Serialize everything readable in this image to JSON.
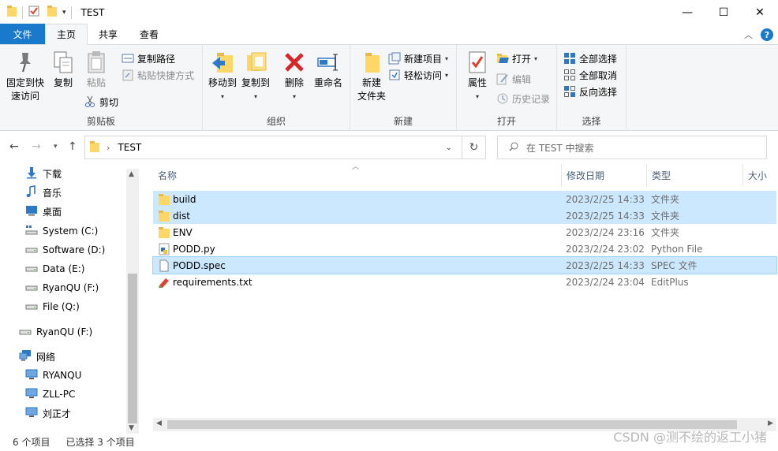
{
  "window": {
    "title": "TEST",
    "minimize_glyph": "—",
    "maximize_glyph": "☐",
    "close_glyph": "✕"
  },
  "tabs": {
    "file": "文件",
    "home": "主页",
    "share": "共享",
    "view": "查看",
    "help_glyph": "?"
  },
  "ribbon": {
    "clipboard": {
      "label": "剪贴板",
      "pin": "固定到快\n速访问",
      "copy": "复制",
      "paste": "粘贴",
      "copy_path": "复制路径",
      "paste_shortcut": "粘贴快捷方式",
      "cut": "剪切"
    },
    "organize": {
      "label": "组织",
      "move_to": "移动到",
      "copy_to": "复制到",
      "delete": "删除",
      "rename": "重命名"
    },
    "new": {
      "label": "新建",
      "new_folder": "新建\n文件夹",
      "new_item": "新建项目",
      "easy_access": "轻松访问"
    },
    "open": {
      "label": "打开",
      "properties": "属性",
      "open": "打开",
      "edit": "编辑",
      "history": "历史记录"
    },
    "select": {
      "label": "选择",
      "select_all": "全部选择",
      "select_none": "全部取消",
      "invert": "反向选择"
    }
  },
  "address": {
    "path": "TEST",
    "search_placeholder": "在 TEST 中搜索"
  },
  "nav": [
    {
      "label": "下载",
      "icon": "download-icon"
    },
    {
      "label": "音乐",
      "icon": "music-icon"
    },
    {
      "label": "桌面",
      "icon": "desktop-icon"
    },
    {
      "label": "System (C:)",
      "icon": "drive-icon"
    },
    {
      "label": "Software (D:)",
      "icon": "drive-icon"
    },
    {
      "label": "Data (E:)",
      "icon": "drive-icon"
    },
    {
      "label": "RyanQU (F:)",
      "icon": "drive-icon"
    },
    {
      "label": "File (Q:)",
      "icon": "drive-icon"
    },
    {
      "label": "RyanQU (F:)",
      "icon": "drive-icon"
    },
    {
      "label": "网络",
      "icon": "network-icon"
    },
    {
      "label": "RYANQU",
      "icon": "computer-icon"
    },
    {
      "label": "ZLL-PC",
      "icon": "computer-icon"
    },
    {
      "label": "刘正才",
      "icon": "computer-icon"
    }
  ],
  "columns": {
    "name": "名称",
    "date": "修改日期",
    "type": "类型",
    "size": "大小"
  },
  "files": [
    {
      "name": "build",
      "date": "2023/2/25 14:33",
      "type": "文件夹",
      "selected": true,
      "icon": "folder-icon"
    },
    {
      "name": "dist",
      "date": "2023/2/25 14:33",
      "type": "文件夹",
      "selected": true,
      "icon": "folder-icon"
    },
    {
      "name": "ENV",
      "date": "2023/2/24 23:16",
      "type": "文件夹",
      "selected": false,
      "icon": "folder-icon"
    },
    {
      "name": "PODD.py",
      "date": "2023/2/24 23:02",
      "type": "Python File",
      "selected": false,
      "icon": "python-file-icon"
    },
    {
      "name": "PODD.spec",
      "date": "2023/2/25 14:33",
      "type": "SPEC 文件",
      "selected": true,
      "icon": "file-icon"
    },
    {
      "name": "requirements.txt",
      "date": "2023/2/24 23:04",
      "type": "EditPlus",
      "selected": false,
      "icon": "editplus-file-icon"
    }
  ],
  "status": {
    "count": "6 个项目",
    "selected": "已选择 3 个项目"
  },
  "watermark": "CSDN @测不绘的返工小猪"
}
